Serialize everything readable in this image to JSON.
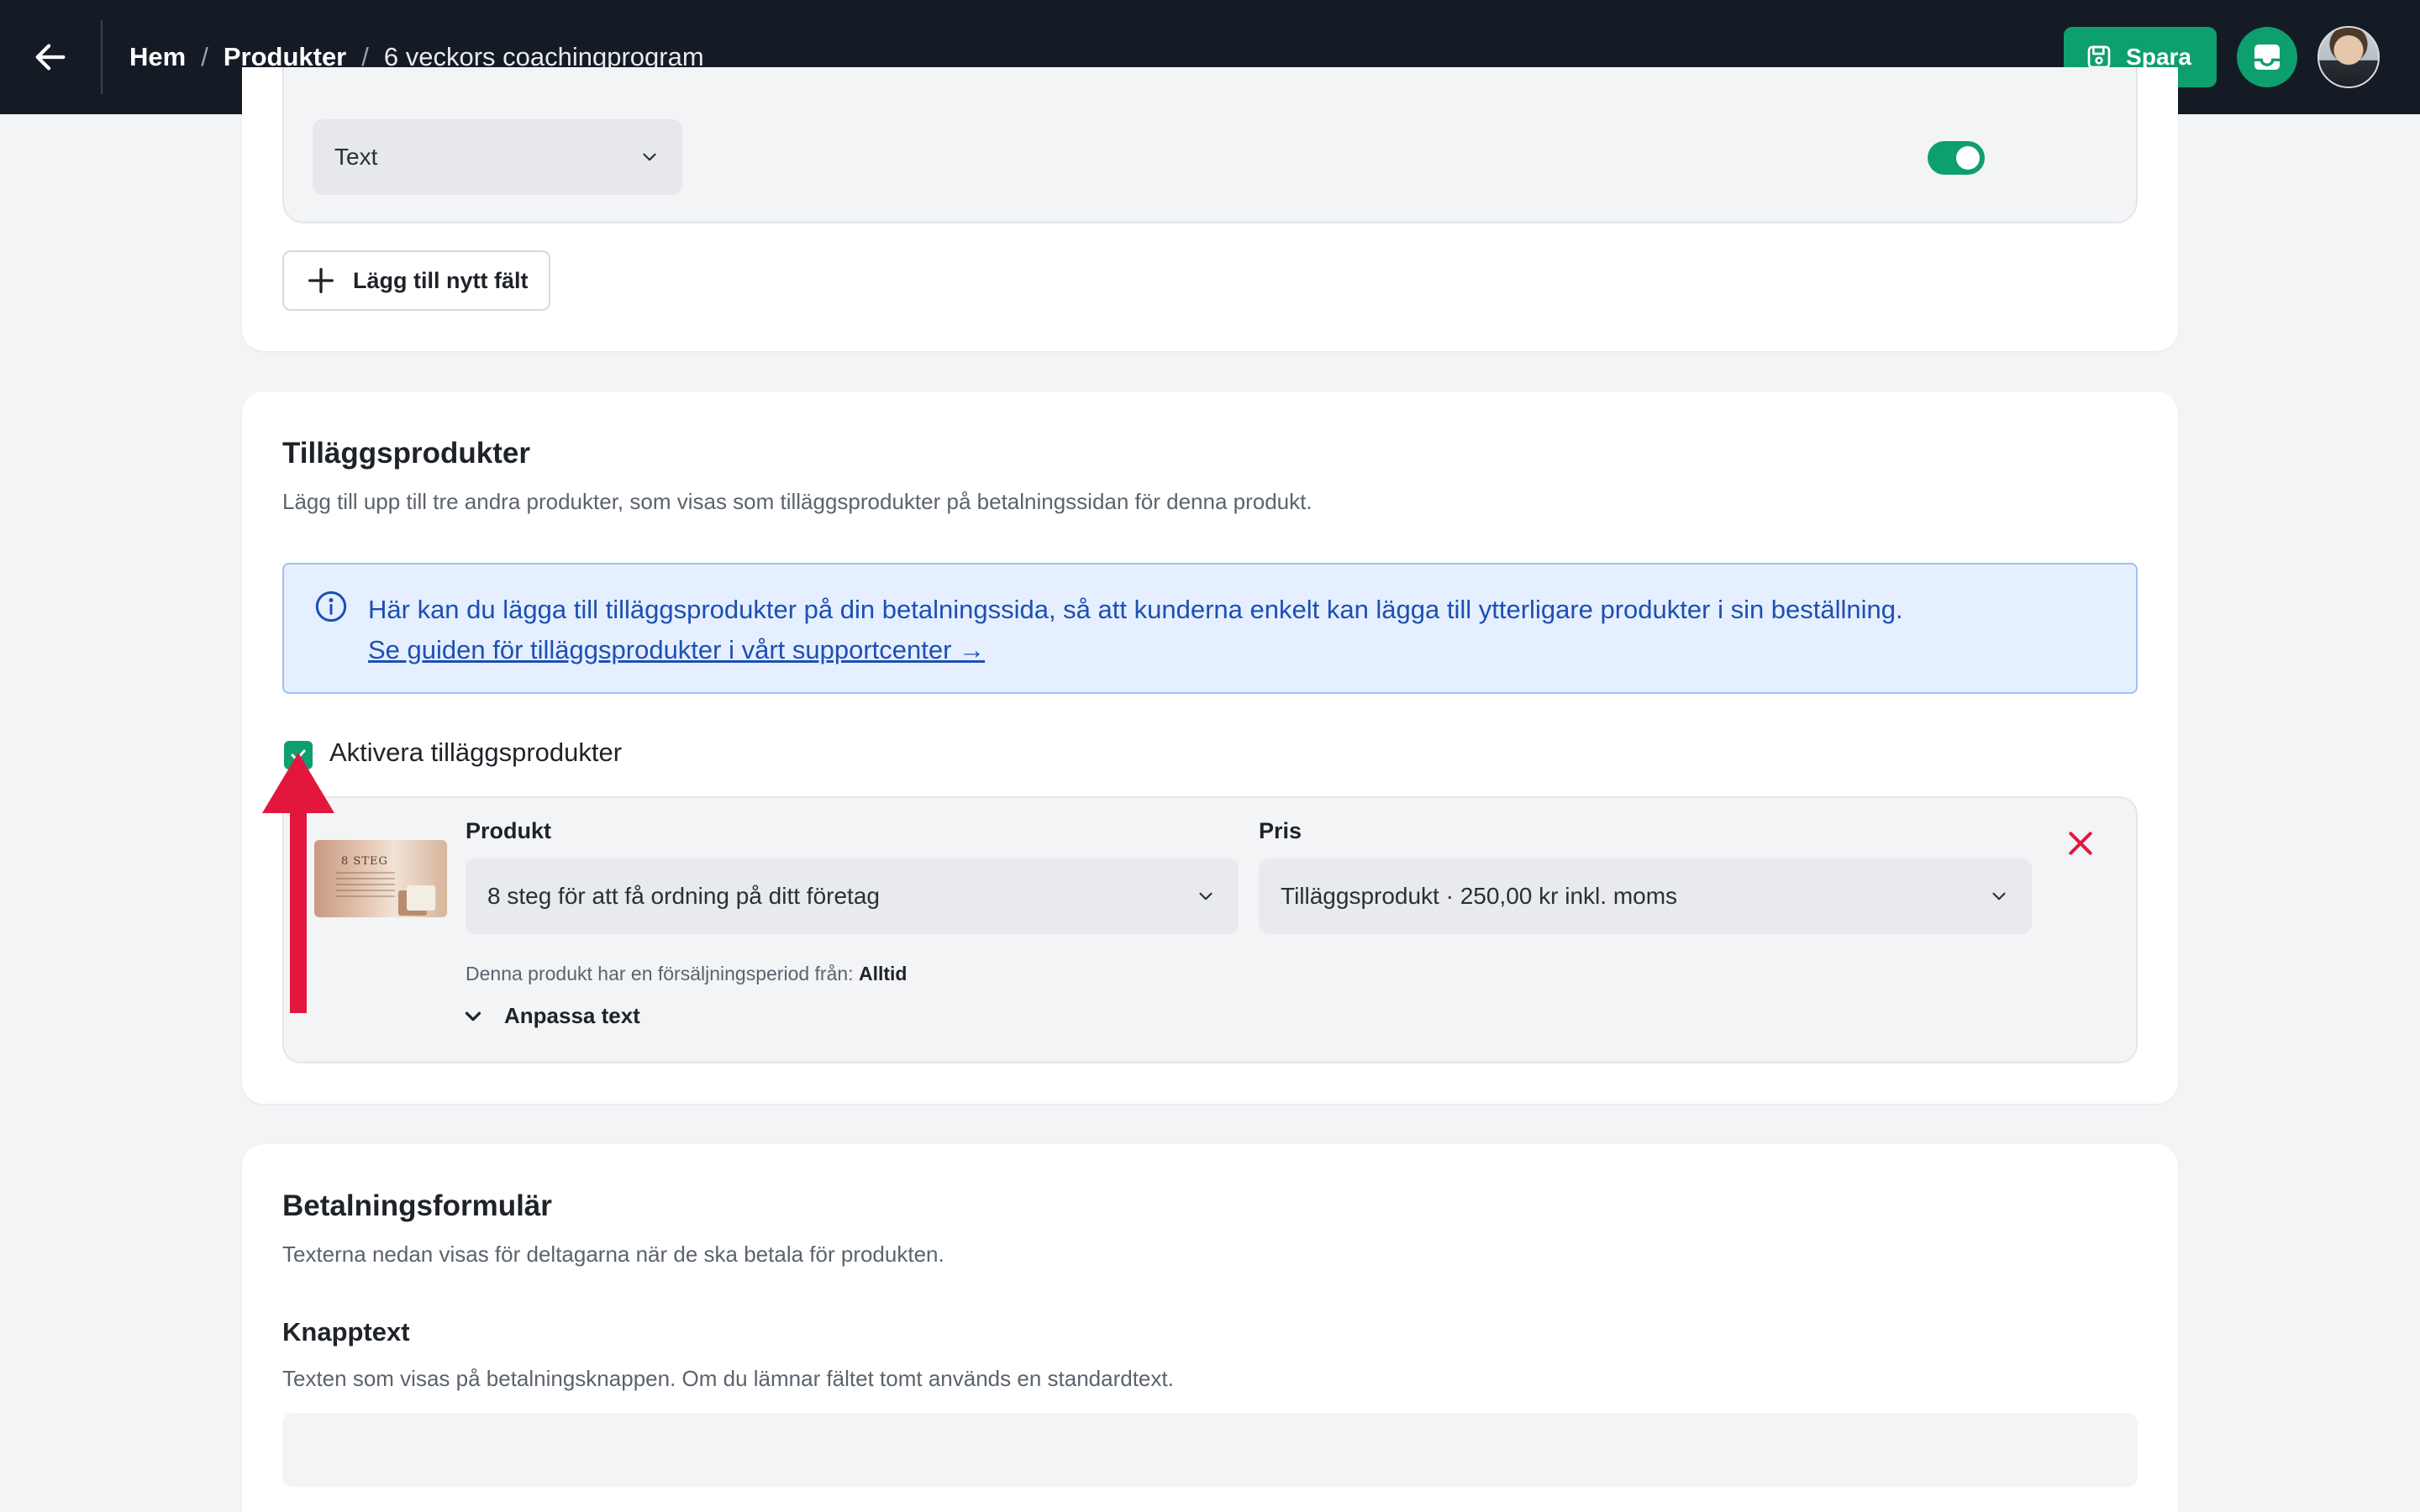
{
  "header": {
    "breadcrumb": {
      "home": "Hem",
      "separator": "/",
      "products": "Produkter",
      "current": "6 veckors coachingprogram"
    },
    "save_label": "Spara"
  },
  "custom_fields": {
    "type_select_value": "Text",
    "required_toggle_on": true,
    "add_field_label": "Lägg till nytt fält"
  },
  "addons": {
    "title": "Tilläggsprodukter",
    "description": "Lägg till upp till tre andra produkter, som visas som tilläggsprodukter på betalningssidan för denna produkt.",
    "info_text": "Här kan du lägga till tilläggsprodukter på din betalningssida, så att kunderna enkelt kan lägga till ytterligare produkter i sin beställning.",
    "info_link": "Se guiden för tilläggsprodukter i vårt supportcenter →",
    "enable_label": "Aktivera tilläggsprodukter",
    "enabled": true,
    "item": {
      "thumb_title": "8 STEG",
      "product_label": "Produkt",
      "product_value": "8 steg för att få ordning på ditt företag",
      "price_label": "Pris",
      "price_value": "Tilläggsprodukt · 250,00 kr inkl. moms",
      "sale_period_prefix": "Denna produkt har en försäljningsperiod från:",
      "sale_period_value": "Alltid",
      "customize_label": "Anpassa text"
    }
  },
  "payment_form": {
    "title": "Betalningsformulär",
    "description": "Texterna nedan visas för deltagarna när de ska betala för produkten.",
    "button_text_title": "Knapptext",
    "button_text_description": "Texten som visas på betalningsknappen. Om du lämnar fältet tomt används en standardtext.",
    "button_text_value": ""
  },
  "colors": {
    "topbar": "#151b24",
    "accent_green": "#0e9f6e",
    "info_blue": "#1d4fb4",
    "danger_red": "#e3173e",
    "annotation": "#e3173e"
  }
}
